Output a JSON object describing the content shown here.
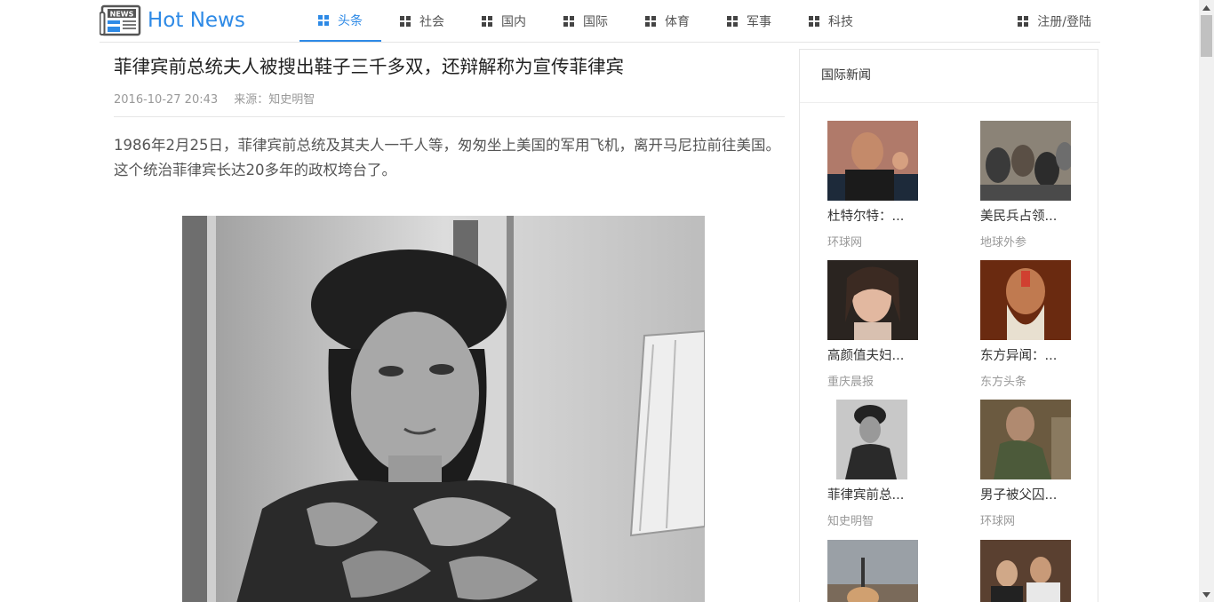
{
  "header": {
    "logo_text": "Hot News",
    "logo_badge": "NEWS",
    "nav": [
      {
        "label": "头条",
        "active": true
      },
      {
        "label": "社会"
      },
      {
        "label": "国内"
      },
      {
        "label": "国际"
      },
      {
        "label": "体育"
      },
      {
        "label": "军事"
      },
      {
        "label": "科技"
      }
    ],
    "login_label": "注册/登陆"
  },
  "article": {
    "title": "菲律宾前总统夫人被搜出鞋子三千多双，还辩解称为宣传菲律宾",
    "date": "2016-10-27 20:43",
    "source": "来源：知史明智",
    "body": "1986年2月25日，菲律宾前总统及其夫人一千人等，匆匆坐上美国的军用飞机，离开马尼拉前往美国。这个统治菲律宾长达20多年的政权垮台了。"
  },
  "sidebar": {
    "title": "国际新闻",
    "items": [
      {
        "title": "杜特尔特：...",
        "source": "环球网"
      },
      {
        "title": "美民兵占领...",
        "source": "地球外参"
      },
      {
        "title": "高颜值夫妇...",
        "source": "重庆晨报"
      },
      {
        "title": "东方异闻：...",
        "source": "东方头条"
      },
      {
        "title": "菲律宾前总...",
        "source": "知史明智"
      },
      {
        "title": "男子被父囚...",
        "source": "环球网"
      },
      {
        "title": "",
        "source": ""
      },
      {
        "title": "",
        "source": ""
      }
    ]
  },
  "colors": {
    "accent": "#2e8ae6",
    "muted": "#999999",
    "border": "#e5e5e5"
  }
}
